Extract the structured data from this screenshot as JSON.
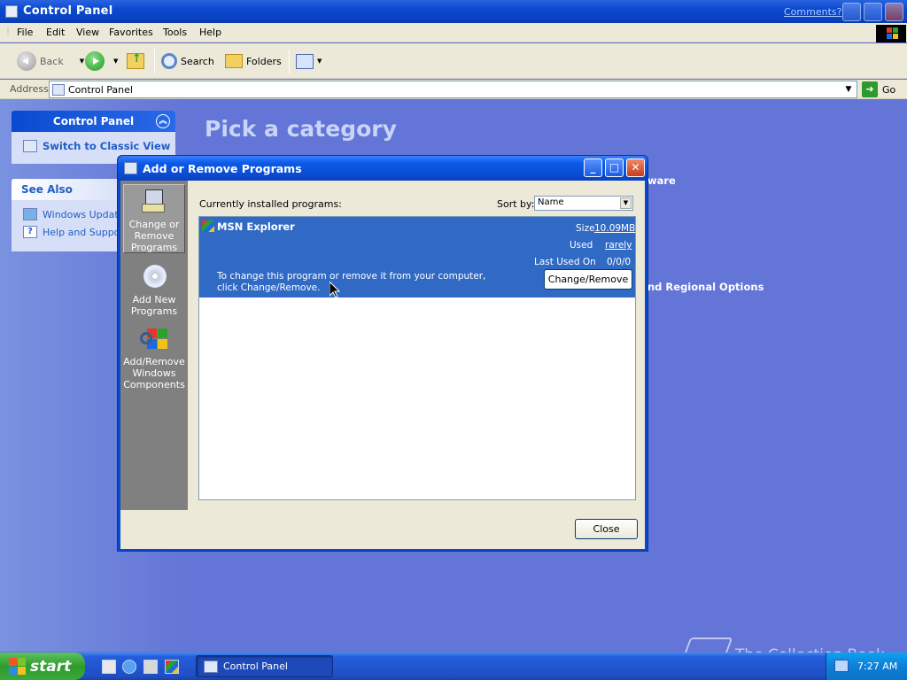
{
  "window": {
    "title": "Control Panel",
    "comments_link": "Comments?"
  },
  "menu": [
    "File",
    "Edit",
    "View",
    "Favorites",
    "Tools",
    "Help"
  ],
  "toolbar": {
    "back_label": "Back",
    "search_label": "Search",
    "folders_label": "Folders"
  },
  "address": {
    "label": "Address",
    "value": "Control Panel",
    "go_label": "Go"
  },
  "sidebar": {
    "control_panel_title": "Control Panel",
    "switch_view": "Switch to Classic View",
    "see_also_title": "See Also",
    "see_also_items": [
      "Windows Update",
      "Help and Support"
    ]
  },
  "main": {
    "heading": "Pick a category",
    "partial_items": [
      "ware",
      "nd Regional Options"
    ]
  },
  "dialog": {
    "title": "Add or Remove Programs",
    "side_buttons": [
      "Change or Remove Programs",
      "Add New Programs",
      "Add/Remove Windows Components"
    ],
    "currently_installed_label": "Currently installed programs:",
    "sort_by_label": "Sort by:",
    "sort_by_value": "Name",
    "programs": [
      {
        "name": "MSN Explorer",
        "size_label": "Size",
        "size_value": "10.09MB",
        "used_label": "Used",
        "used_value": "rarely",
        "last_used_label": "Last Used On",
        "last_used_value": "0/0/0",
        "description": "To change this program or remove it from your computer, click Change/Remove.",
        "action_label": "Change/Remove"
      }
    ],
    "close_label": "Close"
  },
  "taskbar": {
    "start_label": "start",
    "active_task": "Control Panel",
    "clock": "7:27 AM"
  },
  "watermark": "The Collection Book",
  "colors": {
    "desktop_blue": "#6375d6",
    "title_blue": "#0a4ad0",
    "selection_blue": "#316ac5",
    "start_green": "#2f9b2f",
    "window_face": "#ece9d8"
  }
}
